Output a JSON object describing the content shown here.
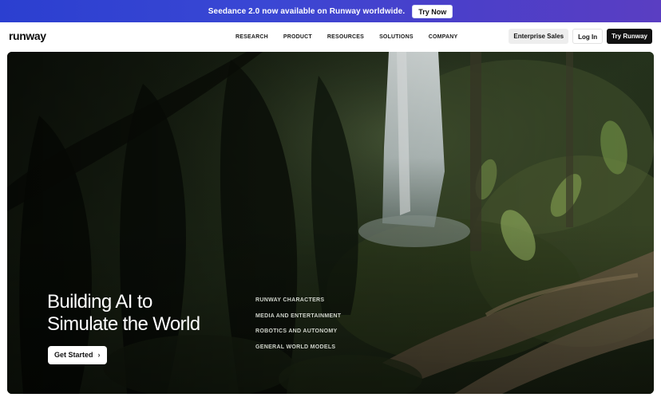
{
  "banner": {
    "text": "Seedance 2.0 now available on Runway worldwide.",
    "cta_label": "Try Now"
  },
  "nav": {
    "logo": "runway",
    "links": [
      "RESEARCH",
      "PRODUCT",
      "RESOURCES",
      "SOLUTIONS",
      "COMPANY"
    ],
    "enterprise_label": "Enterprise Sales",
    "login_label": "Log In",
    "try_label": "Try Runway"
  },
  "hero": {
    "title_line1": "Building AI to",
    "title_line2": "Simulate the World",
    "cta_label": "Get Started",
    "cta_icon": "chevron-right-icon",
    "list": [
      "RUNWAY CHARACTERS",
      "MEDIA AND ENTERTAINMENT",
      "ROBOTICS AND AUTONOMY",
      "GENERAL WORLD MODELS"
    ]
  },
  "colors": {
    "banner_gradient_start": "#2b3fd0",
    "banner_gradient_end": "#5a3ec2",
    "primary_button": "#111111",
    "secondary_button": "#eeeeee"
  }
}
